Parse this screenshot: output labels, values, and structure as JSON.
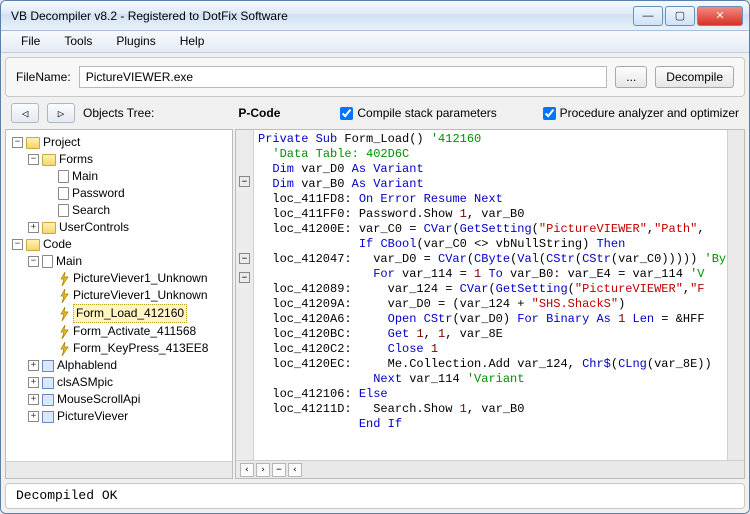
{
  "window": {
    "title": "VB Decompiler v8.2 - Registered to DotFix Software"
  },
  "menu": {
    "file": "File",
    "tools": "Tools",
    "plugins": "Plugins",
    "help": "Help"
  },
  "filerow": {
    "label": "FileName:",
    "value": "PictureVIEWER.exe",
    "browse": "...",
    "decompile": "Decompile"
  },
  "navrow": {
    "tree_label": "Objects Tree:",
    "code_heading": "P-Code",
    "chk1": "Compile stack parameters",
    "chk2": "Procedure analyzer and optimizer"
  },
  "tree": {
    "project": "Project",
    "forms": "Forms",
    "forms_items": [
      "Main",
      "Password",
      "Search"
    ],
    "usercontrols": "UserControls",
    "code": "Code",
    "main": "Main",
    "methods": [
      "PictureViever1_Unknown",
      "PictureViever1_Unknown",
      "Form_Load_412160",
      "Form_Activate_411568",
      "Form_KeyPress_413EE8"
    ],
    "mods": [
      "Alphablend",
      "clsASMpic",
      "MouseScrollApi",
      "PictureViever"
    ]
  },
  "toolbar": {
    "b1": "‹",
    "b2": "›",
    "b3": "−",
    "b4": "‹"
  },
  "status": "Decompiled OK",
  "chart_data": null
}
